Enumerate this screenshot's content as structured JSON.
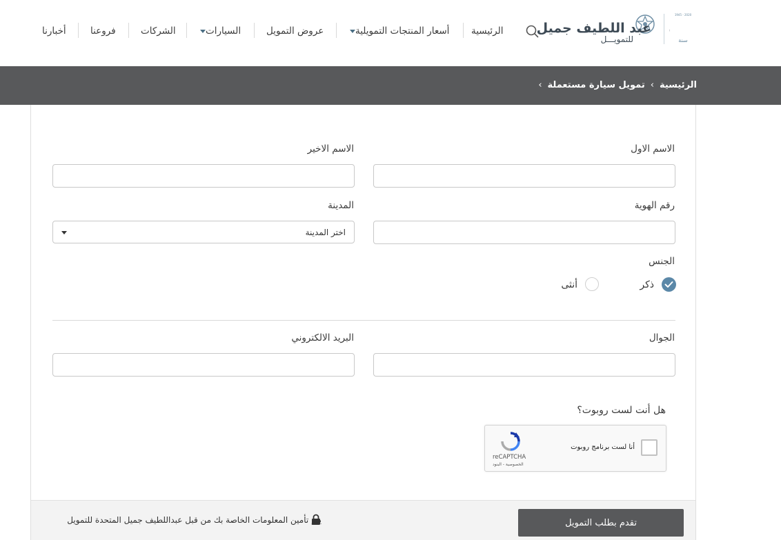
{
  "brand": {
    "name_main": "عبد اللطيف جميل",
    "name_sub": "للتمويـــل",
    "anniversary_number": "75",
    "anniversary_years": "2020 - 1945",
    "anniversary_word": "سنة"
  },
  "nav": {
    "items": [
      {
        "label": "الرئيسية",
        "has_dropdown": false
      },
      {
        "label": "أسعار المنتجات التمويلية",
        "has_dropdown": true
      },
      {
        "label": "عروض التمويل",
        "has_dropdown": false
      },
      {
        "label": "السيارات",
        "has_dropdown": true
      },
      {
        "label": "الشركات",
        "has_dropdown": false
      },
      {
        "label": "فروعنا",
        "has_dropdown": false
      },
      {
        "label": "أخبارنا",
        "has_dropdown": false
      }
    ]
  },
  "breadcrumb": {
    "home": "الرئيسية",
    "current": "تمويل سيارة مستعملة",
    "separator": "›"
  },
  "form": {
    "first_name": {
      "label": "الاسم الاول",
      "value": ""
    },
    "last_name": {
      "label": "الاسم الاخير",
      "value": ""
    },
    "id_number": {
      "label": "رقم الهوية",
      "value": ""
    },
    "city": {
      "label": "المدينة",
      "selected": "اختر المدينة"
    },
    "gender": {
      "label": "الجنس",
      "options": [
        "ذكر",
        "أنثى"
      ],
      "selected": "ذكر"
    },
    "mobile": {
      "label": "الجوال",
      "value": ""
    },
    "email": {
      "label": "البريد الالكتروني",
      "value": ""
    },
    "robot_question": "هل أنت لست روبوت؟"
  },
  "captcha": {
    "checkbox_label": "أنا لست برنامج روبوت",
    "brand": "reCAPTCHA",
    "links": "الخصوصية - البنود"
  },
  "footer": {
    "secure_note": "يتم تأمين المعلومات الخاصة بك من قبل عبداللطيف جميل المتحدة للتمويل",
    "submit_label": "تقدم بطلب التمويل"
  },
  "colors": {
    "accent": "#5b88a8",
    "header_bar": "#58595b",
    "button": "#58595b"
  }
}
